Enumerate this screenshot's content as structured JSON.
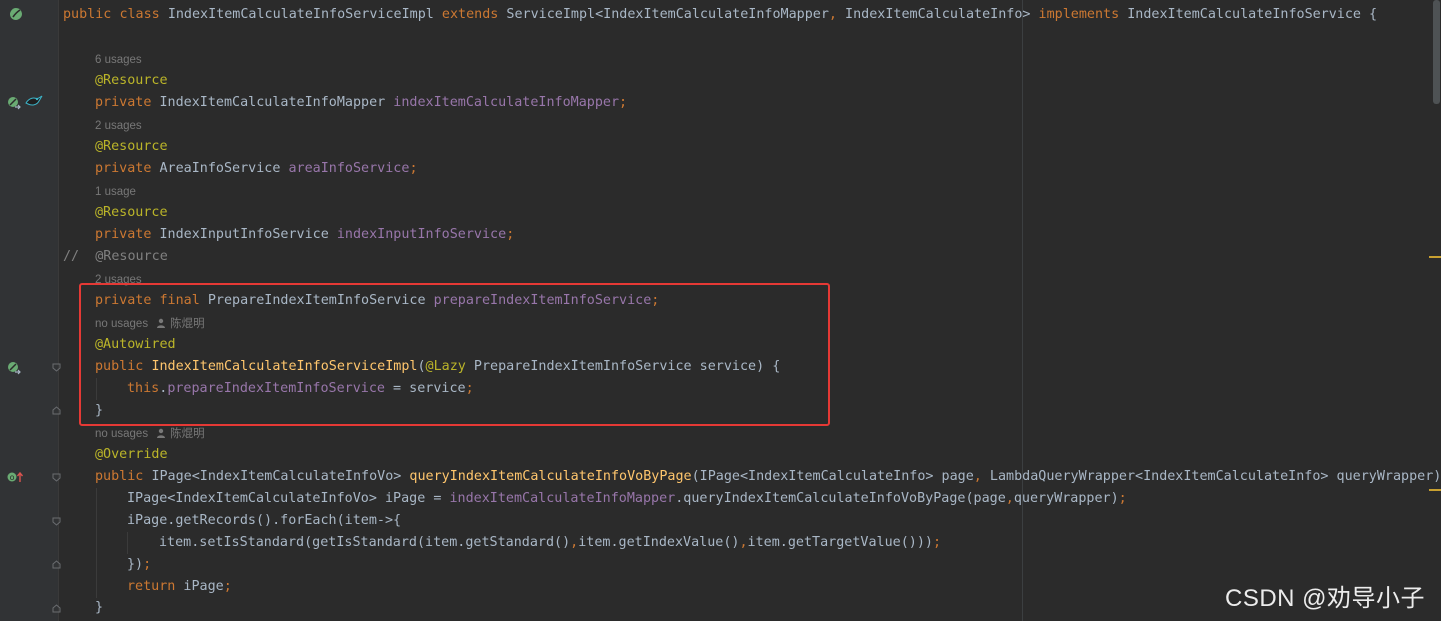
{
  "editor": {
    "class_decl": {
      "public": "public",
      "class": "class",
      "name": "IndexItemCalculateInfoServiceImpl",
      "extends": "extends",
      "parent_open": "ServiceImpl<IndexItemCalculateInfoMapper",
      "comma": ",",
      "parent_rest": " IndexItemCalculateInfo>",
      "implements": "implements",
      "interface": "IndexItemCalculateInfoService {"
    },
    "hints": {
      "h1": "6 usages",
      "h2": "2 usages",
      "h3": "1 usage",
      "h4": "2 usages",
      "h5": "no usages",
      "h5_author": "陈焜明",
      "h6": "no usages",
      "h6_author": "陈焜明"
    },
    "f1": {
      "ann": "@Resource",
      "kw": "private",
      "type": "IndexItemCalculateInfoMapper",
      "field": "indexItemCalculateInfoMapper",
      "semi": ";"
    },
    "f2": {
      "ann": "@Resource",
      "kw": "private",
      "type": "AreaInfoService",
      "field": "areaInfoService",
      "semi": ";"
    },
    "f3": {
      "ann": "@Resource",
      "kw": "private",
      "type": "IndexInputInfoService",
      "field": "indexInputInfoService",
      "semi": ";"
    },
    "commented": {
      "slashes": "//",
      "text": "@Resource"
    },
    "f4": {
      "kw1": "private",
      "kw2": "final",
      "type": "PrepareIndexItemInfoService",
      "field": "prepareIndexItemInfoService",
      "semi": ";"
    },
    "ctor": {
      "ann": "@Autowired",
      "kw": "public",
      "name": "IndexItemCalculateInfoServiceImpl",
      "paren_open": "(",
      "param_ann": "@Lazy",
      "param_rest": " PrepareIndexItemInfoService service) {",
      "this_kw": "this",
      "dot": ".",
      "this_field": "prepareIndexItemInfoService",
      "assign": " = service",
      "semi": ";",
      "close": "}"
    },
    "method": {
      "ann": "@Override",
      "kw": "public",
      "ret_type": "IPage<IndexItemCalculateInfoVo>",
      "name": "queryIndexItemCalculateInfoVoByPage",
      "params_a": "(IPage<IndexItemCalculateInfo> page",
      "comma": ",",
      "params_b": " LambdaQueryWrapper<IndexItemCalculateInfo> queryWrapper) {",
      "l1_a": "IPage<IndexItemCalculateInfoVo> iPage = ",
      "l1_field": "indexItemCalculateInfoMapper",
      "l1_b": ".queryIndexItemCalculateInfoVoByPage(page",
      "l1_comma": ",",
      "l1_c": "queryWrapper)",
      "l1_semi": ";",
      "l2": "iPage.getRecords().forEach(item->{",
      "l3_a": "item.setIsStandard(getIsStandard(item.getStandard()",
      "l3_c1": ",",
      "l3_b": "item.getIndexValue()",
      "l3_c2": ",",
      "l3_c": "item.getTargetValue()))",
      "l3_semi": ";",
      "l4_a": "})",
      "l4_semi": ";",
      "l5_kw": "return",
      "l5_b": " iPage",
      "l5_semi": ";",
      "l6": "}"
    }
  },
  "watermark": "CSDN @劝导小子",
  "colors": {
    "background": "#2b2b2b",
    "keyword": "#cc7832",
    "annotation": "#bbb529",
    "field": "#9876aa",
    "method_decl": "#ffc66d",
    "highlight_box": "#e53935"
  }
}
